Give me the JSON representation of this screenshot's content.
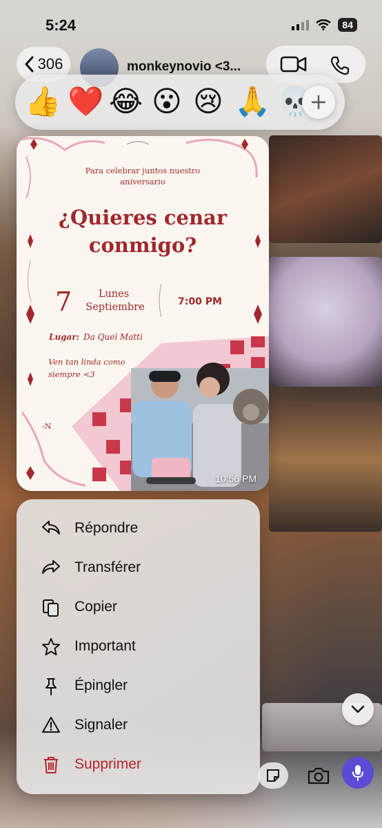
{
  "status_bar": {
    "time": "5:24",
    "battery": "84"
  },
  "header": {
    "back_count": "306",
    "contact_name": "monkeynovio <3..."
  },
  "reactions": [
    {
      "emoji": "👍",
      "name": "thumbs-up"
    },
    {
      "emoji": "❤️",
      "name": "heart"
    },
    {
      "emoji": "😂",
      "name": "laughing"
    },
    {
      "emoji": "😮",
      "name": "surprised"
    },
    {
      "emoji": "😢",
      "name": "crying"
    },
    {
      "emoji": "🙏",
      "name": "praying-hands"
    },
    {
      "emoji": "💀",
      "name": "skull"
    }
  ],
  "invitation": {
    "subtitle_line1": "Para celebrar juntos nuestro",
    "subtitle_line2": "aniversario",
    "headline_line1": "¿Quieres cenar",
    "headline_line2": "conmigo?",
    "day_number": "7",
    "weekday": "Lunes",
    "month": "Septiembre",
    "time": "7:00 PM",
    "place_label": "Lugar:",
    "place_value": "Da Queì Matti",
    "note_line1": "Ven tan linda como",
    "note_line2": "siempre <3",
    "signature": "-N",
    "timestamp": "10:56 PM"
  },
  "context_menu": [
    {
      "label": "Répondre",
      "icon": "reply-icon"
    },
    {
      "label": "Transférer",
      "icon": "forward-icon"
    },
    {
      "label": "Copier",
      "icon": "copy-icon"
    },
    {
      "label": "Important",
      "icon": "star-icon"
    },
    {
      "label": "Épingler",
      "icon": "pin-icon"
    },
    {
      "label": "Signaler",
      "icon": "warning-icon"
    },
    {
      "label": "Supprimer",
      "icon": "trash-icon"
    }
  ],
  "colors": {
    "accent_red": "#a0282e",
    "danger": "#b3262b",
    "mic_purple": "#5b4bd5"
  }
}
